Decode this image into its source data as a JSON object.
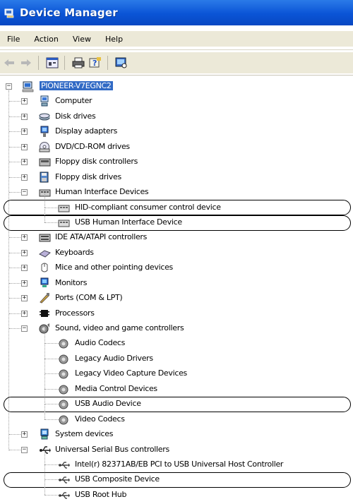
{
  "window": {
    "title": "Device Manager"
  },
  "menu": [
    "File",
    "Action",
    "View",
    "Help"
  ],
  "toolbar": [
    "back-icon",
    "forward-icon",
    "properties-icon",
    "print-icon",
    "help-icon",
    "scan-hardware-icon"
  ],
  "tree": {
    "root": "PIONEER-V7EGNC2",
    "nodes": [
      {
        "label": "Computer",
        "depth": 1,
        "expander": "+",
        "icon": "computer-icon"
      },
      {
        "label": "Disk drives",
        "depth": 1,
        "expander": "+",
        "icon": "disk-drive-icon"
      },
      {
        "label": "Display adapters",
        "depth": 1,
        "expander": "+",
        "icon": "display-adapter-icon"
      },
      {
        "label": "DVD/CD-ROM drives",
        "depth": 1,
        "expander": "+",
        "icon": "dvd-drive-icon"
      },
      {
        "label": "Floppy disk controllers",
        "depth": 1,
        "expander": "+",
        "icon": "floppy-controller-icon"
      },
      {
        "label": "Floppy disk drives",
        "depth": 1,
        "expander": "+",
        "icon": "floppy-drive-icon"
      },
      {
        "label": "Human Interface Devices",
        "depth": 1,
        "expander": "-",
        "icon": "hid-icon"
      },
      {
        "label": "HID-compliant consumer control device",
        "depth": 2,
        "expander": "",
        "icon": "hid-device-icon",
        "highlighted": true
      },
      {
        "label": "USB Human Interface Device",
        "depth": 2,
        "expander": "",
        "icon": "hid-device-icon",
        "highlighted": true
      },
      {
        "label": "IDE ATA/ATAPI controllers",
        "depth": 1,
        "expander": "+",
        "icon": "ide-controller-icon"
      },
      {
        "label": "Keyboards",
        "depth": 1,
        "expander": "+",
        "icon": "keyboard-icon"
      },
      {
        "label": "Mice and other pointing devices",
        "depth": 1,
        "expander": "+",
        "icon": "mouse-icon"
      },
      {
        "label": "Monitors",
        "depth": 1,
        "expander": "+",
        "icon": "monitor-icon"
      },
      {
        "label": "Ports (COM & LPT)",
        "depth": 1,
        "expander": "+",
        "icon": "port-icon"
      },
      {
        "label": "Processors",
        "depth": 1,
        "expander": "+",
        "icon": "processor-icon"
      },
      {
        "label": "Sound, video and game controllers",
        "depth": 1,
        "expander": "-",
        "icon": "sound-icon"
      },
      {
        "label": "Audio Codecs",
        "depth": 2,
        "expander": "",
        "icon": "sound-device-icon"
      },
      {
        "label": "Legacy Audio Drivers",
        "depth": 2,
        "expander": "",
        "icon": "sound-device-icon"
      },
      {
        "label": "Legacy Video Capture Devices",
        "depth": 2,
        "expander": "",
        "icon": "sound-device-icon"
      },
      {
        "label": "Media Control Devices",
        "depth": 2,
        "expander": "",
        "icon": "sound-device-icon"
      },
      {
        "label": "USB Audio Device",
        "depth": 2,
        "expander": "",
        "icon": "sound-device-icon",
        "highlighted": true
      },
      {
        "label": "Video Codecs",
        "depth": 2,
        "expander": "",
        "icon": "sound-device-icon"
      },
      {
        "label": "System devices",
        "depth": 1,
        "expander": "+",
        "icon": "system-device-icon"
      },
      {
        "label": "Universal Serial Bus controllers",
        "depth": 1,
        "expander": "-",
        "icon": "usb-icon"
      },
      {
        "label": "Intel(r) 82371AB/EB PCI to USB Universal Host Controller",
        "depth": 2,
        "expander": "",
        "icon": "usb-device-icon"
      },
      {
        "label": "USB Composite Device",
        "depth": 2,
        "expander": "",
        "icon": "usb-device-icon",
        "highlighted": true
      },
      {
        "label": "USB Root Hub",
        "depth": 2,
        "expander": "",
        "icon": "usb-device-icon"
      }
    ]
  },
  "colors": {
    "titlebar": "#0a54d6",
    "selection": "#316ac5",
    "menubar": "#ece9d8",
    "highlight_outline": "#000000"
  }
}
